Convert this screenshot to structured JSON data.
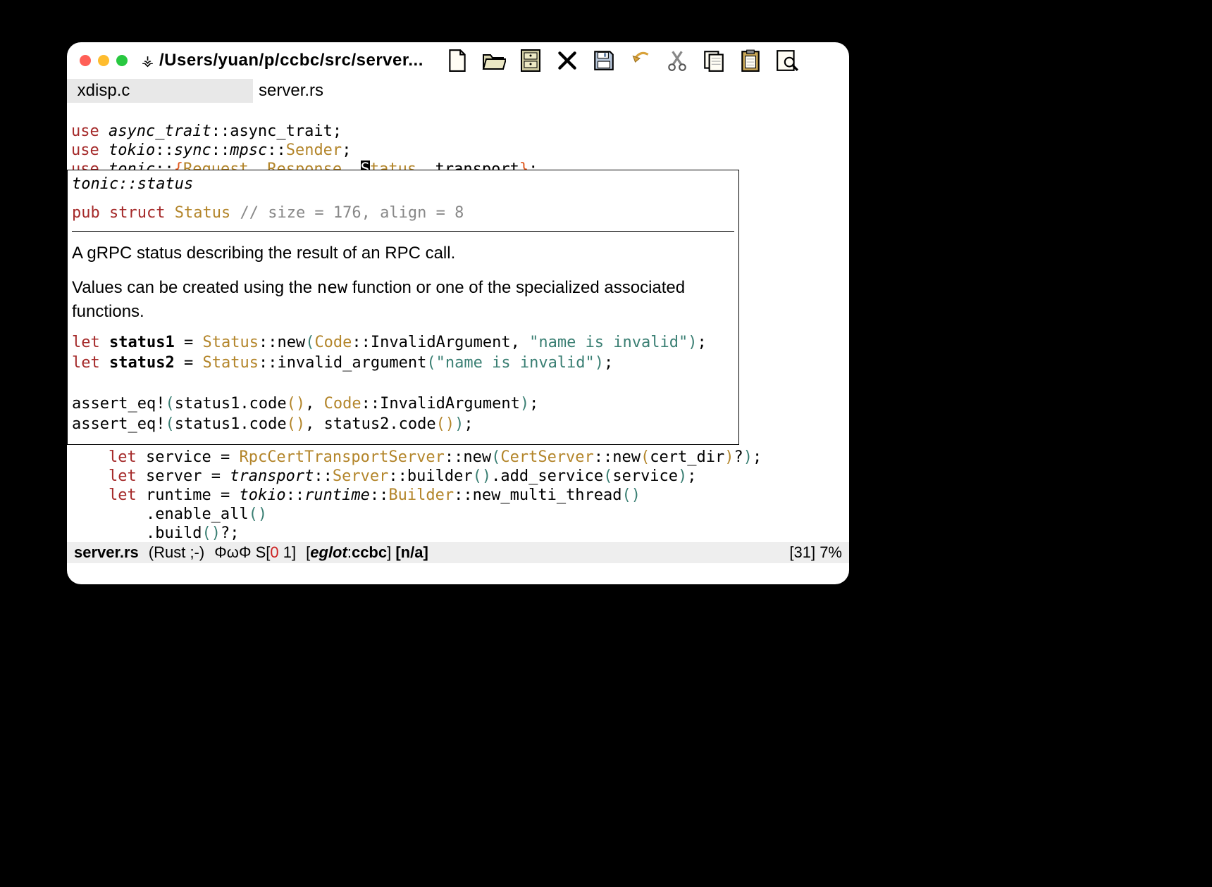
{
  "window": {
    "title_path": "/Users/yuan/p/ccbc/src/server..."
  },
  "tabs": [
    {
      "label": " xdisp.c",
      "active": true
    },
    {
      "label": "server.rs",
      "active": false
    }
  ],
  "code_top": {
    "l1_use": "use",
    "l1_ital": "async_trait",
    "l1_rest": "::async_trait;",
    "l2_use": "use",
    "l2_ital": "tokio",
    "l2_a": "::",
    "l2_sync": "sync",
    "l2_b": "::",
    "l2_mpsc": "mpsc",
    "l2_c": "::",
    "l2_sender": "Sender",
    "l2_semi": ";",
    "l3_use": "use",
    "l3_ital": "tonic",
    "l3_a": "::",
    "l3_lbrace": "{",
    "l3_req": "Request",
    "l3_c1": ", ",
    "l3_resp": "Response",
    "l3_c2": ", ",
    "l3_cursor": "S",
    "l3_status_rest": "tatus",
    "l3_c3": ", ",
    "l3_transport": "transport",
    "l3_rbrace": "}",
    "l3_semi": ";"
  },
  "hover": {
    "path": "tonic::status",
    "pub": "pub",
    "struct": "struct",
    "name": "Status",
    "comment": "// size = 176, align = 8",
    "prose1": "A gRPC status describing the result of an RPC call.",
    "prose2a": "Values can be created using the ",
    "prose2_mono": "new",
    "prose2b": " function or one of the specialized associated functions.",
    "ex1_let": "let",
    "ex1_var": "status1",
    "ex1_eq": " = ",
    "ex1_status": "Status",
    "ex1_new": "::new",
    "ex1_open": "(",
    "ex1_code": "Code",
    "ex1_inv": "::InvalidArgument",
    "ex1_comma": ", ",
    "ex1_str": "\"name is invalid\"",
    "ex1_close": ")",
    "ex1_semi": ";",
    "ex2_let": "let",
    "ex2_var": "status2",
    "ex2_eq": " = ",
    "ex2_status": "Status",
    "ex2_rest": "::invalid_argument",
    "ex2_open": "(",
    "ex2_str": "\"name is invalid\"",
    "ex2_close": ")",
    "ex2_semi": ";",
    "a1_head": "assert_eq!",
    "a1_open": "(",
    "a1_s1": "status1.code",
    "a1_p": "()",
    "a1_c": ", ",
    "a1_code": "Code",
    "a1_inv": "::InvalidArgument",
    "a1_close": ")",
    "a1_semi": ";",
    "a2_head": "assert_eq!",
    "a2_open": "(",
    "a2_s1": "status1.code",
    "a2_p1": "()",
    "a2_c": ", ",
    "a2_s2": "status2.code",
    "a2_p2": "()",
    "a2_close": ")",
    "a2_semi": ";"
  },
  "lower": {
    "l1_indent": "    ",
    "l1_let": "let",
    "l1_svc": " service",
    "l1_eq": " = ",
    "l1_rpc": "RpcCertTransportServer",
    "l1_new": "::new",
    "l1_open": "(",
    "l1_cs": "CertServer",
    "l1_new2": "::new",
    "l1_open2": "(",
    "l1_arg": "cert_dir",
    "l1_close2": ")",
    "l1_q": "?",
    "l1_close": ")",
    "l1_semi": ";",
    "l2_indent": "    ",
    "l2_let": "let",
    "l2_srv": " server",
    "l2_eq": " = ",
    "l2_t": "transport",
    "l2_b": "::",
    "l2_S": "Server",
    "l2_b2": "::builder",
    "l2_p": "()",
    "l2_add": ".add_service",
    "l2_open": "(",
    "l2_arg": "service",
    "l2_close": ")",
    "l2_semi": ";",
    "l3_indent": "    ",
    "l3_let": "let",
    "l3_rt": " runtime",
    "l3_eq": " = ",
    "l3_tokio": "tokio",
    "l3_b1": "::",
    "l3_runtime": "runtime",
    "l3_b2": "::",
    "l3_B": "Builder",
    "l3_m": "::new_multi_thread",
    "l3_p": "()",
    "l4_indent": "        ",
    "l4_ena": ".enable_all",
    "l4_p": "()",
    "l5_indent": "        ",
    "l5_b": ".build",
    "l5_p": "()",
    "l5_q": "?;"
  },
  "modeline": {
    "buffer": "server.rs",
    "mode": "(Rust ;-)",
    "flymake_prefix": "ΦωΦ   S[",
    "flymake_err": "0",
    "flymake_warn": " 1",
    "flymake_suffix": "]",
    "eglot_open": "[",
    "eglot_label": "eglot",
    "eglot_colon": ":",
    "eglot_project": "ccbc",
    "eglot_close": "]",
    "na": " [n/a]",
    "pos_line": "[31]",
    "pos_pct": " 7%"
  },
  "icons": {
    "close": "close-icon",
    "minimize": "minimize-icon",
    "zoom": "zoom-icon",
    "vc": "version-control-icon",
    "newfile": "new-file-icon",
    "open": "open-folder-icon",
    "filemgr": "file-manager-icon",
    "kill": "close-buffer-icon",
    "save": "save-icon",
    "undo": "undo-icon",
    "cut": "cut-icon",
    "copy": "copy-icon",
    "paste": "paste-icon",
    "search": "search-icon"
  }
}
